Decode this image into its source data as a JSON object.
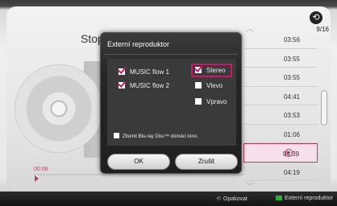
{
  "header": {
    "page_indicator": "9/16",
    "background_title": "Stopa"
  },
  "tracks": [
    {
      "time": "03:56",
      "active": false
    },
    {
      "time": "03:55",
      "active": false
    },
    {
      "time": "03:55",
      "active": false
    },
    {
      "time": "04:41",
      "active": false
    },
    {
      "time": "03:53",
      "active": false
    },
    {
      "time": "01:06",
      "active": false
    },
    {
      "time": "04:39",
      "active": true
    },
    {
      "time": "04:19",
      "active": false
    }
  ],
  "player": {
    "elapsed": "00:08",
    "progress_fraction": 0.0
  },
  "dialog": {
    "title": "Externí reproduktor",
    "devices": [
      {
        "label": "MUSIC flow 1",
        "checked": true
      },
      {
        "label": "MUSIC flow 2",
        "checked": true
      }
    ],
    "channels": [
      {
        "label": "Stereo",
        "checked": true,
        "selected": true
      },
      {
        "label": "Vlevo",
        "checked": false,
        "selected": false
      },
      {
        "label": "Vpravo",
        "checked": false,
        "selected": false
      }
    ],
    "mute_label": "Ztlumit Blu-ray Disc™ domácí kino.",
    "mute_checked": false,
    "ok_label": "OK",
    "cancel_label": "Zrušit"
  },
  "bottom_bar": {
    "repeat_label": "Opakovat",
    "external_label": "Externí reproduktor"
  },
  "colors": {
    "accent": "#d01467",
    "green_key": "#2fae3a"
  }
}
